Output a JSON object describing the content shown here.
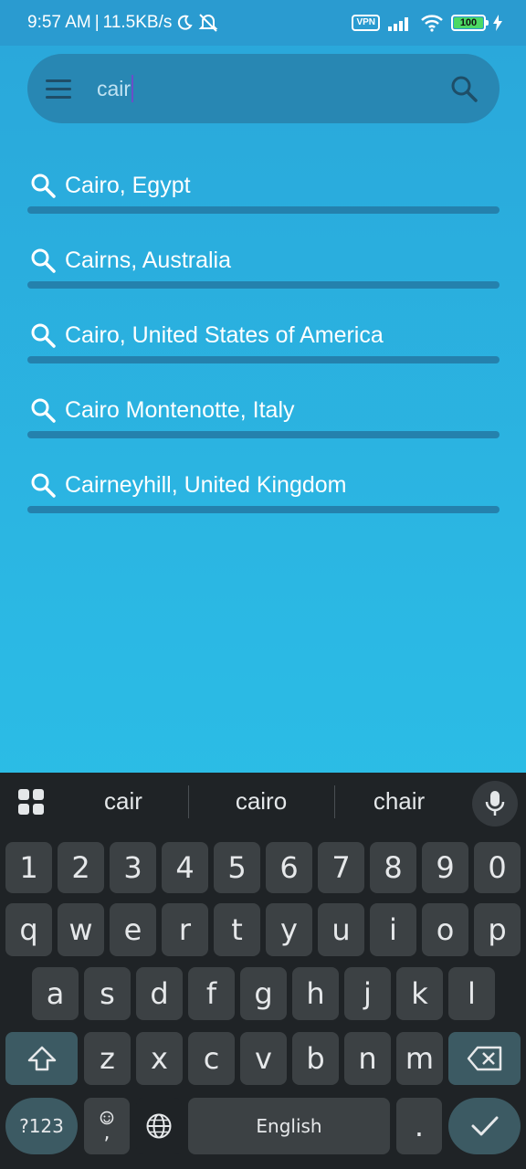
{
  "status_bar": {
    "time": "9:57 AM",
    "separator": "|",
    "net_speed": "11.5KB/s",
    "vpn": "VPN",
    "battery": "100"
  },
  "search": {
    "value": "cair",
    "menu_icon": "hamburger-icon",
    "search_icon": "search-icon"
  },
  "results": [
    {
      "label": "Cairo, Egypt"
    },
    {
      "label": "Cairns, Australia"
    },
    {
      "label": "Cairo, United States of America"
    },
    {
      "label": "Cairo Montenotte, Italy"
    },
    {
      "label": "Cairneyhill, United Kingdom"
    }
  ],
  "keyboard": {
    "suggestions": [
      "cair",
      "cairo",
      "chair"
    ],
    "number_row": [
      "1",
      "2",
      "3",
      "4",
      "5",
      "6",
      "7",
      "8",
      "9",
      "0"
    ],
    "row1": [
      "q",
      "w",
      "e",
      "r",
      "t",
      "y",
      "u",
      "i",
      "o",
      "p"
    ],
    "row2": [
      "a",
      "s",
      "d",
      "f",
      "g",
      "h",
      "j",
      "k",
      "l"
    ],
    "row3": [
      "z",
      "x",
      "c",
      "v",
      "b",
      "n",
      "m"
    ],
    "symbols_key": "?123",
    "comma_key": ",",
    "space_label": "English",
    "period_key": "."
  },
  "colors": {
    "background_top": "#2aa7da",
    "background_bottom": "#2cc6ea",
    "search_bar": "#2887b3",
    "result_underline": "#2481ad",
    "keyboard_bg": "#1f2326",
    "caret": "#6a4fc7"
  }
}
